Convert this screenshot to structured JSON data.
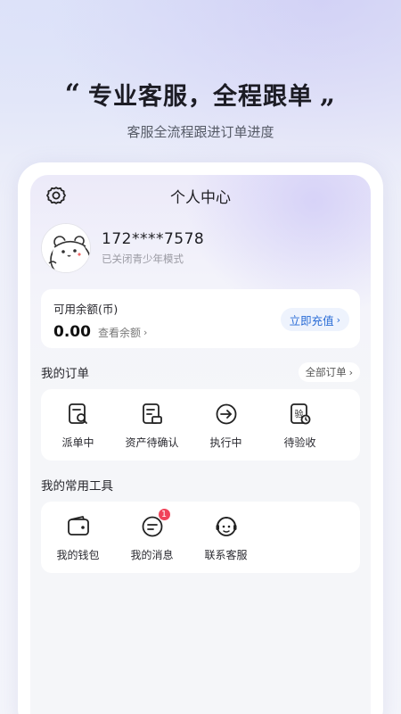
{
  "promo": {
    "open_quote": "“",
    "title": "专业客服，全程跟单",
    "close_quote": "„",
    "subtitle": "客服全流程跟进订单进度"
  },
  "header": {
    "title": "个人中心",
    "settings_icon": "gear-icon"
  },
  "profile": {
    "phone": "172****7578",
    "teen_mode": "已关闭青少年模式",
    "avatar_icon": "bear-avatar"
  },
  "balance": {
    "label": "可用余额(币)",
    "value": "0.00",
    "view_label": "查看余额",
    "recharge_label": "立即充值",
    "accent": "#2a6cd6"
  },
  "orders": {
    "title": "我的订单",
    "all_label": "全部订单",
    "items": [
      {
        "label": "派单中",
        "icon": "order-search-icon"
      },
      {
        "label": "资产待确认",
        "icon": "asset-confirm-icon"
      },
      {
        "label": "执行中",
        "icon": "arrow-circle-icon"
      },
      {
        "label": "待验收",
        "icon": "inspect-clock-icon"
      }
    ]
  },
  "tools": {
    "title": "我的常用工具",
    "items": [
      {
        "label": "我的钱包",
        "icon": "wallet-icon"
      },
      {
        "label": "我的消息",
        "icon": "message-icon",
        "badge": "1"
      },
      {
        "label": "联系客服",
        "icon": "support-icon"
      }
    ],
    "badge_color": "#f0435a"
  },
  "inspect_glyph": "验"
}
